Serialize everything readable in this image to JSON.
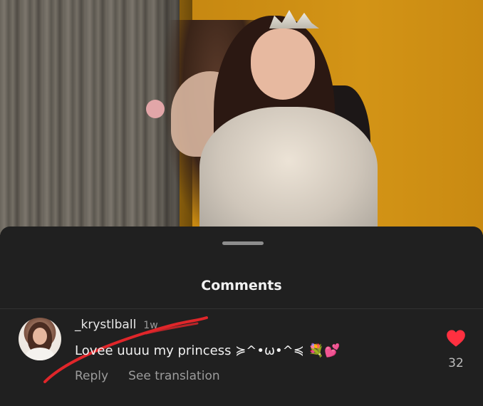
{
  "sheet": {
    "title": "Comments"
  },
  "comment": {
    "username": "_krystlball",
    "time": "1w",
    "text": "Lovee uuuu my princess ≽^•ω•^≼ 💐💕",
    "actions": {
      "reply": "Reply",
      "translate": "See translation"
    },
    "likes": "32",
    "liked": true
  },
  "colors": {
    "sheet_bg": "#202020",
    "text": "#f0f0f0",
    "muted": "#9c9c9c",
    "heart": "#ff3040",
    "scribble": "#e0262a"
  },
  "icons": {
    "like": "heart-icon",
    "handle": "drag-handle"
  }
}
